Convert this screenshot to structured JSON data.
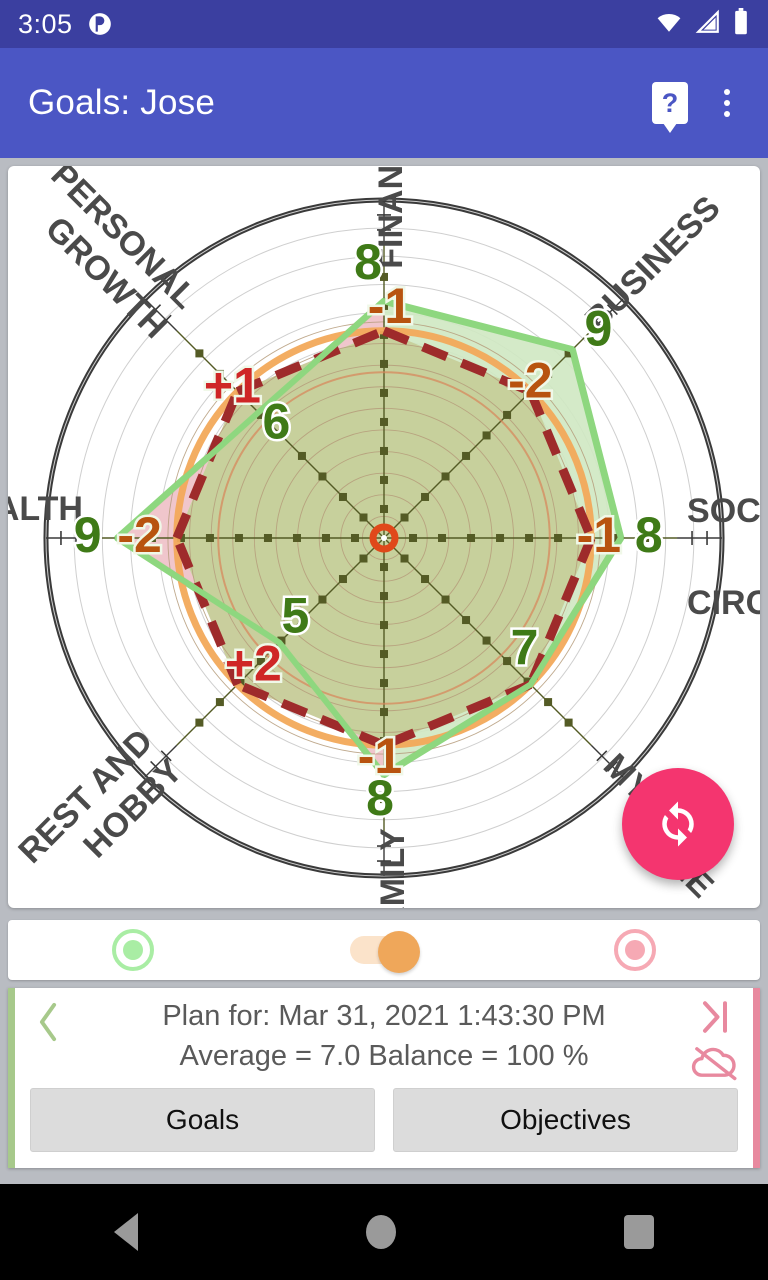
{
  "status_bar": {
    "time": "3:05",
    "notification_icon": "app-notification-icon",
    "wifi_icon": "wifi-icon",
    "signal_icon": "cell-signal-icon",
    "battery_icon": "battery-full-icon"
  },
  "app_bar": {
    "title": "Goals: Jose",
    "help_label": "?",
    "overflow_icon": "more-vert-icon"
  },
  "fab": {
    "icon": "sync-icon"
  },
  "mode_strip": {
    "left_radio": {
      "name": "goals-radio",
      "color": "#a9eda4"
    },
    "toggle": {
      "name": "plan-toggle",
      "color": "#efa75a",
      "track_color": "#fbe3ca"
    },
    "right_radio": {
      "name": "objectives-radio",
      "color": "#f6a9b4"
    }
  },
  "plan_panel": {
    "prev_label": "‹",
    "next_label": "›|",
    "cloud_icon": "cloud-off-icon",
    "line1": "Plan for: Mar 31, 2021 1:43:30 PM",
    "line2": "Average = 7.0 Balance = 100 %",
    "goals_button": "Goals",
    "objectives_button": "Objectives"
  },
  "nav_bar": {
    "back": "back-icon",
    "home": "home-icon",
    "recents": "recents-icon"
  },
  "chart_data": {
    "type": "radar",
    "title": "Goals: Jose",
    "categories": [
      "FINANCES",
      "BUSINESS",
      "SOCIAL CIRCLE",
      "MY HOME",
      "FAMILY",
      "REST AND HOBBY",
      "HEALTH",
      "PERSONAL GROWTH"
    ],
    "values": [
      8,
      9,
      8,
      7,
      8,
      5,
      9,
      6
    ],
    "deltas": [
      "-1",
      "-2",
      "-1",
      "",
      "-1",
      "+2",
      "-2",
      "+1"
    ],
    "delta_signs": [
      "neg",
      "neg",
      "neg",
      "none",
      "neg",
      "pos",
      "neg",
      "pos"
    ],
    "axis_angles_deg": [
      90,
      45,
      0,
      -45,
      -90,
      -135,
      180,
      135
    ],
    "rmin": 0,
    "rmax": 10,
    "rings": 10,
    "series": [
      {
        "name": "Current (green fill)",
        "values": [
          8,
          9,
          8,
          7,
          8,
          5,
          9,
          6
        ],
        "color": "#8ed77f"
      },
      {
        "name": "Plan (crimson dashed)",
        "values": [
          7,
          7,
          7,
          7,
          7,
          7,
          7,
          7
        ],
        "color": "#9e2b2b"
      },
      {
        "name": "Average ring (orange)",
        "value": 7.0,
        "color": "#f2a95a"
      },
      {
        "name": "Inner ring (salmon)",
        "value": 5.6,
        "color": "#d9845a"
      }
    ],
    "center_marker_color": "#e0481a",
    "fill_positive_color": "#c6cf9a",
    "fill_negative_color": "#f5c0cc",
    "grid_color": "#cfcfcf",
    "outer_ring_color": "#3a3a3a",
    "value_text_color": "#3f7a17",
    "delta_neg_color": "#b8530f",
    "delta_pos_color": "#cf2626",
    "label_color": "#4a4a4a",
    "average": 7.0,
    "balance_pct": 100
  }
}
